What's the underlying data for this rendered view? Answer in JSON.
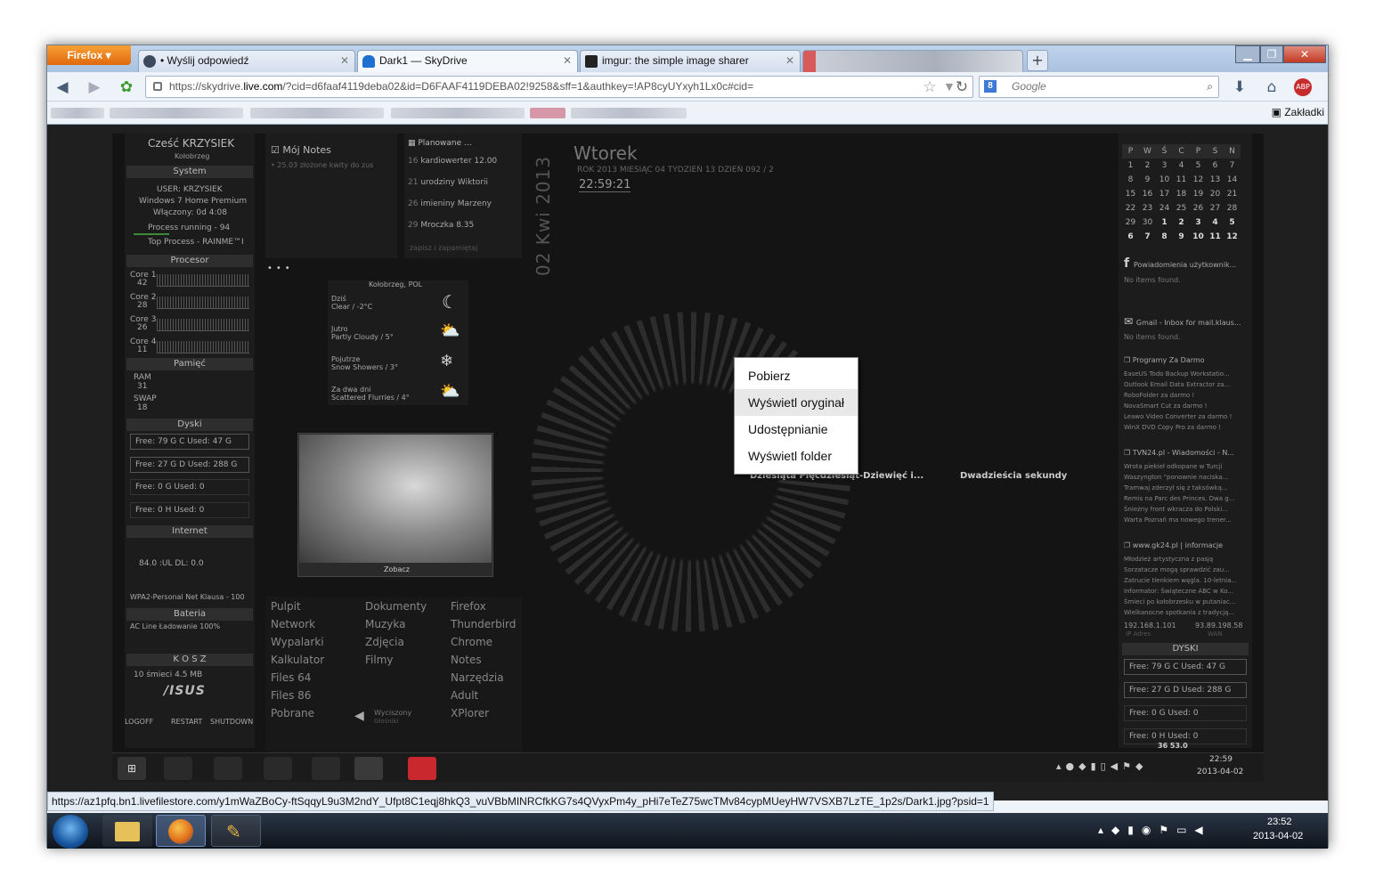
{
  "browser": {
    "menu_button": "Firefox",
    "tabs": [
      {
        "label": "• Wyślij odpowiedź",
        "close": "✕"
      },
      {
        "label": "Dark1 — SkyDrive",
        "close": "✕"
      },
      {
        "label": "imgur: the simple image sharer",
        "close": "✕"
      }
    ],
    "new_tab": "+",
    "window_controls": [
      "▁",
      "❐",
      "✕"
    ],
    "url_prefix": "https://skydrive.",
    "url_domain": "live.com",
    "url_rest": "/?cid=d6faaf4119deba02&id=D6FAAF4119DEBA02!9258&sff=1&authkey=!AP8cyUYxyh1Lx0c#cid=",
    "search_placeholder": "Google",
    "bookmarks_label": "Zakładki",
    "status_url": "https://az1pfq.bn1.livefilestore.com/y1mWaZBoCy-ftSqqyL9u3M2ndY_Ufpt8C1eqj8hkQ3_vuVBbMINRCfkKG7s4QVyxPm4y_pHi7eTeZ75wcTMv84cypMUeyHW7VSXB7LzTE_1p2s/Dark1.jpg?psid=1"
  },
  "context_menu": [
    "Pobierz",
    "Wyświetl oryginał",
    "Udostępnianie",
    "Wyświetl folder"
  ],
  "desktop": {
    "greeting": "Cześć KRZYSIEK",
    "city": "Kołobrzeg",
    "system_hdr": "System",
    "user": "USER: KRZYSIEK",
    "os": "Windows 7 Home Premium",
    "uptime": "Włączony: 0d 4:08",
    "process": "Process running - 94",
    "top_process": "Top Process - RAINME™I",
    "cpu_hdr": "Procesor",
    "cores": [
      {
        "l": "Core 1",
        "v": "42"
      },
      {
        "l": "Core 2",
        "v": "28"
      },
      {
        "l": "Core 3",
        "v": "26"
      },
      {
        "l": "Core 4",
        "v": "11"
      }
    ],
    "mem_hdr": "Pamięć",
    "ram": "RAM",
    "ram_v": "31",
    "swap": "SWAP",
    "swap_v": "18",
    "disk_hdr": "Dyski",
    "disks": [
      "Free: 79 G     C     Used: 47 G",
      "Free: 27 G     D  Used: 288 G",
      "Free: 0        G        Used: 0",
      "Free: 0        H        Used: 0"
    ],
    "net_hdr": "Internet",
    "net_vals": "84.0 :UL      DL: 0.0",
    "wifi": "WPA2-Personal  Net Klausa - 100",
    "bat_hdr": "Bateria",
    "bat": "AC Line    Ładowanie      100%",
    "trash_hdr": "K O S Z",
    "trash": "10 śmieci            4.5 MB",
    "brand": "/ISUS",
    "power": [
      "LOGOFF",
      "RESTART",
      "SHUTDOWN"
    ],
    "notes_title": "Mój Notes",
    "notes_item": "• 25.03 złożone kwity do zus",
    "planned_title": "Planowane ...",
    "planned": [
      {
        "d": "16",
        "t": "kardiowerter 12.00"
      },
      {
        "d": "21",
        "t": "urodziny Wiktorii"
      },
      {
        "d": "26",
        "t": "imieniny Marzeny"
      },
      {
        "d": "29",
        "t": "Mroczka  8.35"
      }
    ],
    "save_note": "zapisz i zapamiętaj",
    "weather_loc": "Kołobrzeg, POL",
    "weather": [
      {
        "d": "Dziś",
        "c": "Clear / -2°C"
      },
      {
        "d": "Jutro",
        "c": "Partly Cloudy / 5°"
      },
      {
        "d": "Pojutrze",
        "c": "Snow Showers / 3°"
      },
      {
        "d": "Za dwa dni",
        "c": "Scattered Flurries / 4°"
      }
    ],
    "photo_caption": "Zobacz",
    "launch": [
      [
        "Pulpit",
        "Dokumenty",
        "Firefox"
      ],
      [
        "Network",
        "Muzyka",
        "Thunderbird"
      ],
      [
        "Wypalarki",
        "Zdjęcia",
        "Chrome"
      ],
      [
        "Kalkulator",
        "Filmy",
        "Notes"
      ],
      [
        "Files 64",
        "",
        "Narzędzia"
      ],
      [
        "Files 86",
        "",
        "Adult"
      ],
      [
        "Pobrane",
        "",
        "XPlorer"
      ]
    ],
    "volume": "Wyciszony",
    "volume_sub": "Głośniki",
    "vertical_date": "02 Kwi 2013",
    "day": "Wtorek",
    "date_line": "ROK 2013  MIESIĄC 04  TYDZIEŃ 13  DZIEŃ 092 / 2",
    "clock": "22:59:21",
    "word_clock_a": "Dziesiąta Pięćdziesiąt-Dziewięć i...",
    "word_clock_b": "Dwadzieścia sekundy",
    "cal_head": [
      "P",
      "W",
      "Ś",
      "C",
      "P",
      "S",
      "N"
    ],
    "cal": [
      [
        "1",
        "2",
        "3",
        "4",
        "5",
        "6",
        "7"
      ],
      [
        "8",
        "9",
        "10",
        "11",
        "12",
        "13",
        "14"
      ],
      [
        "15",
        "16",
        "17",
        "18",
        "19",
        "20",
        "21"
      ],
      [
        "22",
        "23",
        "24",
        "25",
        "26",
        "27",
        "28"
      ],
      [
        "29",
        "30",
        "1",
        "2",
        "3",
        "4",
        "5"
      ],
      [
        "6",
        "7",
        "8",
        "9",
        "10",
        "11",
        "12"
      ]
    ],
    "fb_title": "Powiadomienia użytkownik...",
    "no_items": "No items found.",
    "gmail_title": "Gmail - Inbox for mail.klaus...",
    "feeds": [
      {
        "t": "Programy Za Darmo",
        "i": [
          "EaseUS Todo Backup Workstatio...",
          "Outlook Email Data Extractor za...",
          "RoboFolder za darmo !",
          "NovaSmart Cut za darmo !",
          "Leawo Video Converter za darmo !",
          "WinX DVD Copy Pro za darmo !"
        ]
      },
      {
        "t": "TVN24.pl - Wiadomości - N...",
        "i": [
          "Wrota piekieł odkopane w Turcji",
          "Waszyngton \"ponownie naciska...",
          "Tramwaj zderzył się z taksówką...",
          "Remis na Parc des Princes. Dwa g...",
          "Śnieżny front wkracza do Polski...",
          "Warta Poznań ma nowego trener..."
        ]
      },
      {
        "t": "www.gk24.pl | informacje",
        "i": [
          "Młodzież artystyczna z pasją",
          "Sorzatacze mogą sprawdzić zau...",
          "Zatrucie tlenkiem węgla. 10-letnia...",
          "Informator: Świąteczne ABC w Ko...",
          "Śmieci po kołobrzesku w putaniac...",
          "Wielkanocne spotkania z tradycją..."
        ]
      }
    ],
    "ip": "192.168.1.101",
    "ip_label": "IP Adres",
    "wan": "93.89.198.58",
    "wan_label": "WAN",
    "disks2_hdr": "DYSKI",
    "disks2": [
      "Free: 79 G     C     Used: 47 G",
      "Free: 27 G     D  Used: 288 G",
      "Free: 0        G        Used: 0",
      "Free: 0        H        Used: 0"
    ],
    "tray_vals": "36               53.0",
    "inner_time": "22:59",
    "inner_date": "2013-04-02"
  },
  "taskbar": {
    "time": "23:52",
    "date": "2013-04-02"
  }
}
